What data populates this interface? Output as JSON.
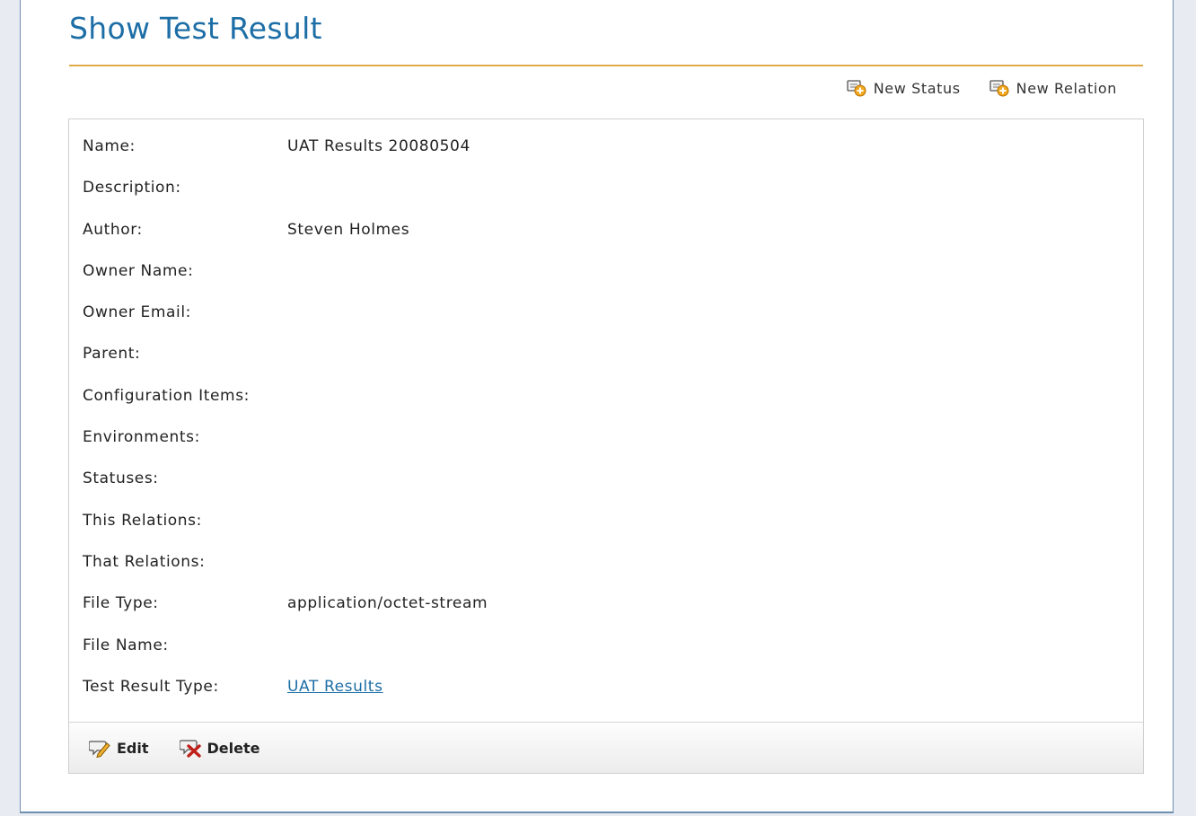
{
  "page": {
    "title": "Show Test Result"
  },
  "actions": {
    "new_status": {
      "label": "New Status",
      "icon": "new-item-icon"
    },
    "new_relation": {
      "label": "New Relation",
      "icon": "new-item-icon"
    }
  },
  "fields": [
    {
      "label": "Name:",
      "value": "UAT Results 20080504"
    },
    {
      "label": "Description:",
      "value": ""
    },
    {
      "label": "Author:",
      "value": "Steven Holmes"
    },
    {
      "label": "Owner Name:",
      "value": ""
    },
    {
      "label": "Owner Email:",
      "value": ""
    },
    {
      "label": "Parent:",
      "value": ""
    },
    {
      "label": "Configuration Items:",
      "value": ""
    },
    {
      "label": "Environments:",
      "value": ""
    },
    {
      "label": "Statuses:",
      "value": ""
    },
    {
      "label": "This Relations:",
      "value": ""
    },
    {
      "label": "That Relations:",
      "value": ""
    },
    {
      "label": "File Type:",
      "value": "application/octet-stream"
    },
    {
      "label": "File Name:",
      "value": ""
    },
    {
      "label": "Test Result Type:",
      "value": "UAT Results",
      "is_link": true
    }
  ],
  "footer": {
    "edit_label": "Edit",
    "delete_label": "Delete"
  },
  "colors": {
    "title": "#1d6ea6",
    "rule": "#e0a94a",
    "link": "#1d6ea6",
    "frame": "#6d8fb0"
  }
}
